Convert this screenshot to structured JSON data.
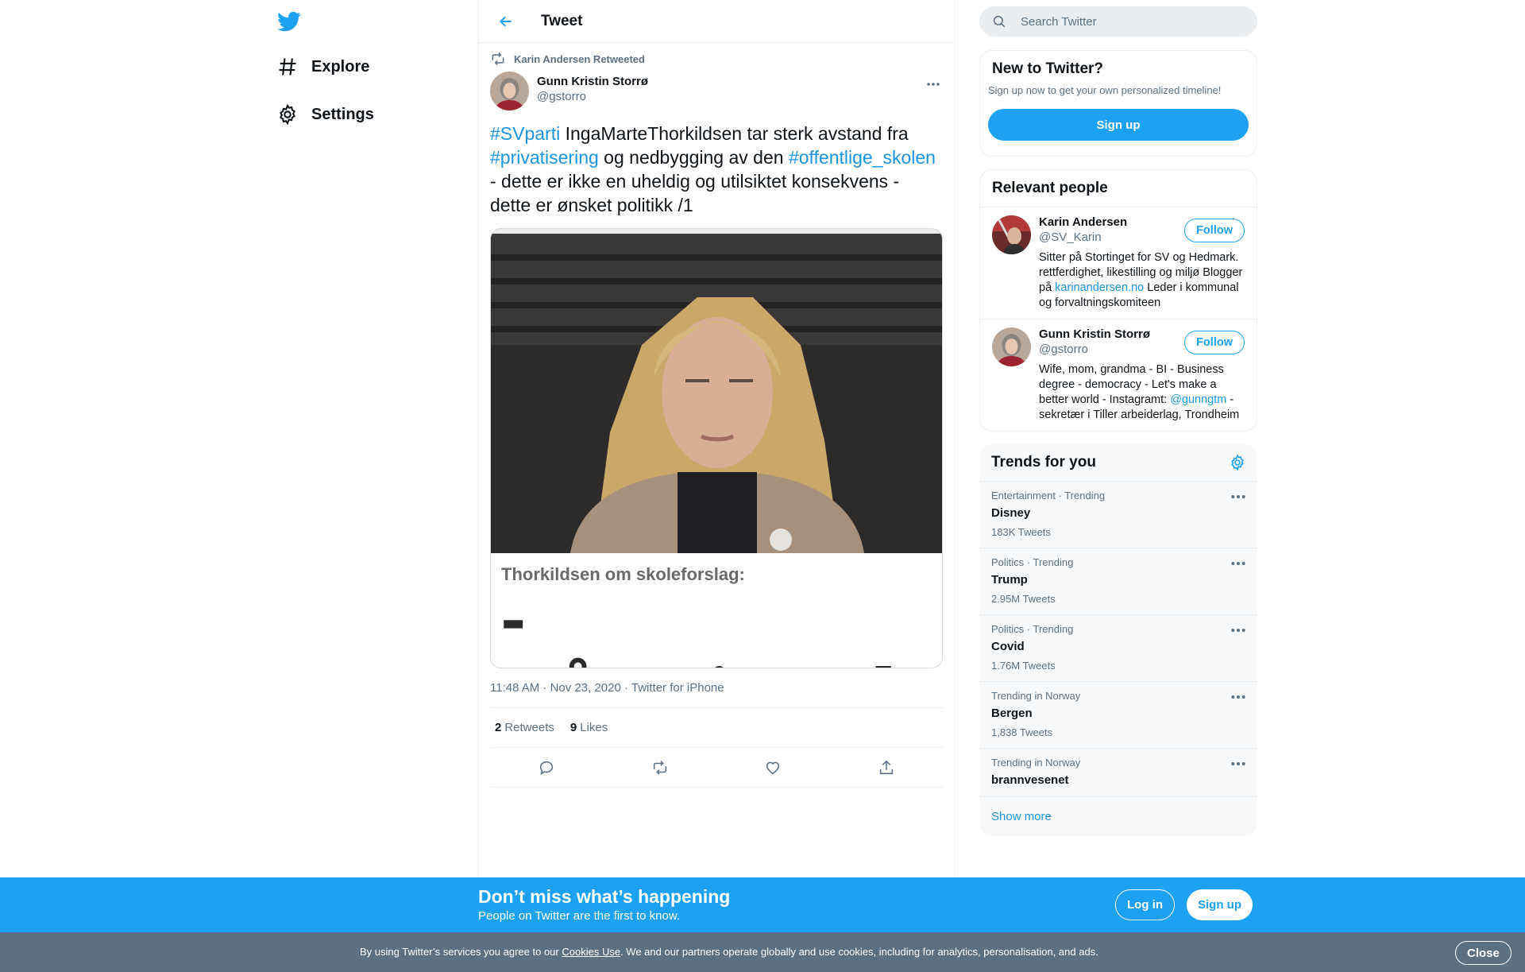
{
  "nav": {
    "logo_icon": "twitter-bird-icon",
    "items": [
      {
        "label": "Explore",
        "icon": "hashtag-icon"
      },
      {
        "label": "Settings",
        "icon": "gear-icon"
      }
    ]
  },
  "header": {
    "title": "Tweet",
    "back_icon": "back-arrow-icon"
  },
  "tweet": {
    "retweeted_by": "Karin Andersen Retweeted",
    "author_name": "Gunn Kristin Storrø",
    "author_handle": "@gstorro",
    "text_parts": [
      {
        "text": "#SVparti",
        "type": "hashtag"
      },
      {
        "text": " IngaMarteThorkildsen tar sterk avstand fra ",
        "type": "text"
      },
      {
        "text": "#privatisering",
        "type": "hashtag"
      },
      {
        "text": " og nedbygging av den ",
        "type": "text"
      },
      {
        "text": "#offentlige_skolen",
        "type": "hashtag"
      },
      {
        "text": " - dette er ikke en uheldig og utilsiktet konsekvens - dette er ønsket politikk /1",
        "type": "text"
      }
    ],
    "media": {
      "caption_small": "Thorkildsen om skoleforslag:",
      "caption_big": "- Hårreisende!"
    },
    "meta": "11:48 AM · Nov 23, 2020 · Twitter for iPhone",
    "retweets_count": "2",
    "retweets_label": "Retweets",
    "likes_count": "9",
    "likes_label": "Likes"
  },
  "search": {
    "placeholder": "Search Twitter"
  },
  "new_to_twitter": {
    "title": "New to Twitter?",
    "subtitle": "Sign up now to get your own personalized timeline!",
    "button": "Sign up"
  },
  "relevant_people": {
    "title": "Relevant people",
    "people": [
      {
        "name": "Karin Andersen",
        "handle": "@SV_Karin",
        "follow": "Follow",
        "bio_before": "Sitter på Stortinget for SV og Hedmark. rettferdighet, likestilling og miljø Blogger på ",
        "bio_link": "karinandersen.no",
        "bio_after": " Leder i kommunal og forvaltningskomiteen"
      },
      {
        "name": "Gunn Kristin Storrø",
        "handle": "@gstorro",
        "follow": "Follow",
        "bio_before": "Wife, mom, grandma - BI - Business degree - democracy - Let's make a better world - Instagramt: ",
        "bio_link": "@gunngtm",
        "bio_after": " - sekretær i Tiller arbeiderlag, Trondheim"
      }
    ]
  },
  "trends": {
    "title": "Trends for you",
    "items": [
      {
        "category": "Entertainment · Trending",
        "name": "Disney",
        "count": "183K Tweets"
      },
      {
        "category": "Politics · Trending",
        "name": "Trump",
        "count": "2.95M Tweets"
      },
      {
        "category": "Politics · Trending",
        "name": "Covid",
        "count": "1.76M Tweets"
      },
      {
        "category": "Trending in Norway",
        "name": "Bergen",
        "count": "1,838 Tweets"
      },
      {
        "category": "Trending in Norway",
        "name": "brannvesenet",
        "count": ""
      }
    ],
    "show_more": "Show more"
  },
  "banner": {
    "headline": "Don’t miss what’s happening",
    "subtext": "People on Twitter are the first to know.",
    "login": "Log in",
    "signup": "Sign up"
  },
  "cookie": {
    "before": "By using Twitter’s services you agree to our ",
    "link": "Cookies Use",
    "after": ". We and our partners operate globally and use cookies, including for analytics, personalisation, and ads.",
    "close": "Close"
  },
  "colors": {
    "accent": "#1da1f2",
    "link": "#1b95e0",
    "secondary_text": "#5b7083",
    "cookie_bar": "#5b7083"
  }
}
